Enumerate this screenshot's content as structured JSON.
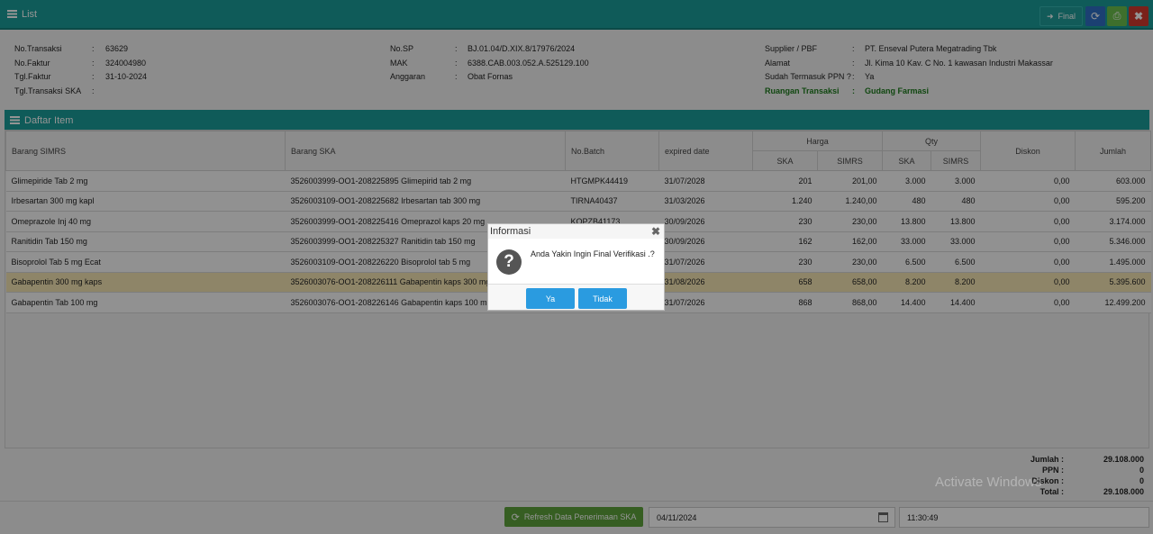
{
  "window": {
    "title": "List",
    "final_label": "Final"
  },
  "header": {
    "no_transaksi": {
      "label": "No.Transaksi",
      "value": "63629"
    },
    "no_faktur": {
      "label": "No.Faktur",
      "value": "324004980"
    },
    "tgl_faktur": {
      "label": "Tgl.Faktur",
      "value": "31-10-2024"
    },
    "tgl_transaksi_ska": {
      "label": "Tgl.Transaksi SKA",
      "value": ""
    },
    "no_sp": {
      "label": "No.SP",
      "value": "BJ.01.04/D.XIX.8/17976/2024"
    },
    "mak": {
      "label": "MAK",
      "value": "6388.CAB.003.052.A.525129.100"
    },
    "anggaran": {
      "label": "Anggaran",
      "value": "Obat Fornas"
    },
    "supplier": {
      "label": "Supplier / PBF",
      "value": "PT. Enseval Putera Megatrading Tbk"
    },
    "alamat": {
      "label": "Alamat",
      "value": "Jl. Kima 10 Kav. C No. 1 kawasan Industri Makassar"
    },
    "ppn": {
      "label": "Sudah Termasuk PPN ?",
      "value": "Ya"
    },
    "ruangan": {
      "label": "Ruangan Transaksi",
      "value": "Gudang Farmasi"
    },
    "colon": ":"
  },
  "items_section": {
    "title": "Daftar Item",
    "columns": {
      "barang_simrs": "Barang SIMRS",
      "barang_ska": "Barang SKA",
      "no_batch": "No.Batch",
      "expired_date": "expired date",
      "harga": "Harga",
      "qty": "Qty",
      "ska": "SKA",
      "simrs": "SIMRS",
      "diskon": "Diskon",
      "jumlah": "Jumlah"
    },
    "rows": [
      {
        "simrs": "Glimepiride Tab 2 mg",
        "ska": "3526003999-OO1-208225895 Glimepirid tab 2 mg",
        "batch": "HTGMPK44419",
        "exp": "31/07/2028",
        "harga_ska": "201",
        "harga_simrs": "201,00",
        "qty_ska": "3.000",
        "qty_simrs": "3.000",
        "diskon": "0,00",
        "jumlah": "603.000"
      },
      {
        "simrs": "Irbesartan 300 mg kapl",
        "ska": "3526003109-OO1-208225682 Irbesartan tab 300 mg",
        "batch": "TIRNA40437",
        "exp": "31/03/2026",
        "harga_ska": "1.240",
        "harga_simrs": "1.240,00",
        "qty_ska": "480",
        "qty_simrs": "480",
        "diskon": "0,00",
        "jumlah": "595.200"
      },
      {
        "simrs": "Omeprazole Inj 40 mg",
        "ska": "3526003999-OO1-208225416 Omeprazol kaps 20 mg",
        "batch": "KOPZB41173",
        "exp": "30/09/2026",
        "harga_ska": "230",
        "harga_simrs": "230,00",
        "qty_ska": "13.800",
        "qty_simrs": "13.800",
        "diskon": "0,00",
        "jumlah": "3.174.000"
      },
      {
        "simrs": "Ranitidin Tab 150 mg",
        "ska": "3526003999-OO1-208225327 Ranitidin tab 150 mg",
        "batch": "",
        "exp": "30/09/2026",
        "harga_ska": "162",
        "harga_simrs": "162,00",
        "qty_ska": "33.000",
        "qty_simrs": "33.000",
        "diskon": "0,00",
        "jumlah": "5.346.000"
      },
      {
        "simrs": "Bisoprolol Tab 5 mg Ecat",
        "ska": "3526003109-OO1-208226220 Bisoprolol tab 5 mg",
        "batch": "",
        "exp": "31/07/2026",
        "harga_ska": "230",
        "harga_simrs": "230,00",
        "qty_ska": "6.500",
        "qty_simrs": "6.500",
        "diskon": "0,00",
        "jumlah": "1.495.000"
      },
      {
        "simrs": "Gabapentin 300 mg kaps",
        "ska": "3526003076-OO1-208226111 Gabapentin kaps 300 mg",
        "batch": "",
        "exp": "31/08/2026",
        "harga_ska": "658",
        "harga_simrs": "658,00",
        "qty_ska": "8.200",
        "qty_simrs": "8.200",
        "diskon": "0,00",
        "jumlah": "5.395.600"
      },
      {
        "simrs": "Gabapentin Tab 100 mg",
        "ska": "3526003076-OO1-208226146 Gabapentin kaps 100 mg",
        "batch": "",
        "exp": "31/07/2026",
        "harga_ska": "868",
        "harga_simrs": "868,00",
        "qty_ska": "14.400",
        "qty_simrs": "14.400",
        "diskon": "0,00",
        "jumlah": "12.499.200"
      }
    ]
  },
  "totals": {
    "jumlah": {
      "label": "Jumlah :",
      "value": "29.108.000"
    },
    "ppn": {
      "label": "PPN :",
      "value": "0"
    },
    "diskon": {
      "label": "Diskon :",
      "value": "0"
    },
    "total": {
      "label": "Total :",
      "value": "29.108.000"
    }
  },
  "footer": {
    "refresh_label": "Refresh Data Penerimaan SKA",
    "date": "04/11/2024",
    "time": "11:30:49"
  },
  "watermark": "Activate Windows",
  "dialog": {
    "title": "Informasi",
    "message": "Anda Yakin Ingin Final Verifikasi .?",
    "yes_label": "Ya",
    "no_label": "Tidak"
  },
  "colors": {
    "header_teal": "#1a9e9a",
    "selected_row": "#f5e6b4",
    "dialog_button": "#2a9be0"
  }
}
